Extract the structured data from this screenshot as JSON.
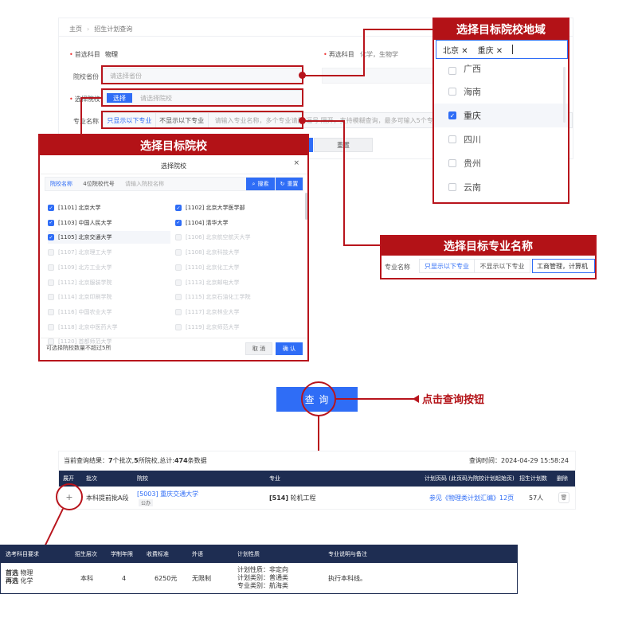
{
  "form": {
    "breadcrumb": [
      "主页",
      "招生计划查询"
    ],
    "first_subject_label": "首选科目",
    "first_subject_value": "物理",
    "second_subject_label": "再选科目",
    "second_subject_value": "化学，生物学",
    "province_label": "院校省份",
    "province_placeholder": "请选择省份",
    "school_label": "选择院校",
    "school_select_button": "选择",
    "school_placeholder": "请选择院校",
    "major_label": "专业名称",
    "major_show_only": "只显示以下专业",
    "major_hide": "不显示以下专业",
    "major_placeholder": "请输入专业名称，多个专业请用 逗号 隔开，支持模糊查询，最多可输入5个专业",
    "reset_button": "重置"
  },
  "region_callout": {
    "title": "选择目标院校地域",
    "tags": [
      "北京",
      "重庆"
    ],
    "items": [
      {
        "label": "广西",
        "checked": false
      },
      {
        "label": "海南",
        "checked": false
      },
      {
        "label": "重庆",
        "checked": true
      },
      {
        "label": "四川",
        "checked": false
      },
      {
        "label": "贵州",
        "checked": false
      },
      {
        "label": "云南",
        "checked": false
      }
    ]
  },
  "school_callout": {
    "title": "选择目标院校",
    "dialog_title": "选择院校",
    "tab_name": "院校名称",
    "tab_code": "4位院校代号",
    "search_placeholder": "请输入院校名称",
    "search_button": "搜索",
    "reset_button": "重置",
    "schools": [
      {
        "label": "[1101] 北京大学",
        "state": "on"
      },
      {
        "label": "[1102] 北京大学医学部",
        "state": "on"
      },
      {
        "label": "[1103] 中国人民大学",
        "state": "on"
      },
      {
        "label": "[1104] 清华大学",
        "state": "on"
      },
      {
        "label": "[1105] 北京交通大学",
        "state": "on"
      },
      {
        "label": "[1106] 北京航空航天大学",
        "state": "dis"
      },
      {
        "label": "[1107] 北京理工大学",
        "state": "dis"
      },
      {
        "label": "[1108] 北京科技大学",
        "state": "dis"
      },
      {
        "label": "[1109] 北方工业大学",
        "state": "dis"
      },
      {
        "label": "[1110] 北京化工大学",
        "state": "dis"
      },
      {
        "label": "[1112] 北京服装学院",
        "state": "dis"
      },
      {
        "label": "[1113] 北京邮电大学",
        "state": "dis"
      },
      {
        "label": "[1114] 北京印刷学院",
        "state": "dis"
      },
      {
        "label": "[1115] 北京石油化工学院",
        "state": "dis"
      },
      {
        "label": "[1116] 中国农业大学",
        "state": "dis"
      },
      {
        "label": "[1117] 北京林业大学",
        "state": "dis"
      },
      {
        "label": "[1118] 北京中医药大学",
        "state": "dis"
      },
      {
        "label": "[1119] 北京师范大学",
        "state": "dis"
      },
      {
        "label": "[1120] 首都师范大学",
        "state": "dis"
      }
    ],
    "limit_note": "可选择院校数量不超过5所",
    "cancel_button": "取 消",
    "confirm_button": "确 认"
  },
  "major_callout": {
    "title": "选择目标专业名称",
    "label": "专业名称",
    "show_only": "只显示以下专业",
    "hide": "不显示以下专业",
    "input_value": "工商管理，计算机"
  },
  "query": {
    "button_label": "查 询",
    "annotation": "点击查询按钮"
  },
  "results": {
    "summary_prefix": "当前查询结果：",
    "batch_count": "7",
    "batch_text": "个批次,",
    "school_count": "5",
    "school_text": "所院校,总计:",
    "record_count": "474",
    "record_text": "条数据",
    "query_time_label": "查询时间：",
    "query_time": "2024-04-29 15:58:24",
    "headers": [
      "展开",
      "批次",
      "院校",
      "专业",
      "计划页码 (此页码为院校计划起始页)",
      "招生计划数",
      "删除"
    ],
    "row": {
      "expand": "+",
      "batch": "本科提前批A段",
      "school": "[5003] 重庆交通大学",
      "school_tag": "公办",
      "major_code": "[514]",
      "major_name": "轮机工程",
      "plan_page": "参见《物理类计划汇编》12页",
      "plan_count": "57人"
    }
  },
  "detail": {
    "headers": [
      "选考科目要求",
      "招生层次",
      "学制年限",
      "收费标准",
      "外语",
      "计划性质",
      "专业说明与备注"
    ],
    "first_label": "首选",
    "first_value": "物理",
    "second_label": "再选",
    "second_value": "化学",
    "level": "本科",
    "years": "4",
    "fee": "6250元",
    "language": "无限制",
    "nature": [
      "计划性质：非定向",
      "计划类别：普通类",
      "专业类别：航海类"
    ],
    "remark": "执行本科线。"
  },
  "colors": {
    "accent_red": "#b31217",
    "primary_blue": "#2f6df6",
    "table_header": "#1e2d52"
  }
}
